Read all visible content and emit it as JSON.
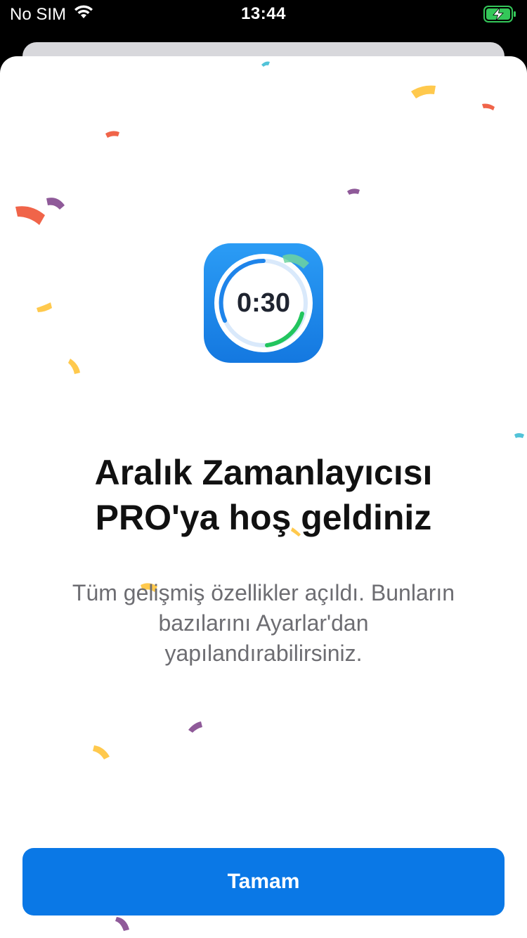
{
  "status_bar": {
    "carrier": "No SIM",
    "time": "13:44",
    "wifi_icon": "wifi-icon",
    "battery_icon": "battery-charging-icon",
    "battery_color": "#34c759"
  },
  "app_icon": {
    "icon": "interval-timer-app-icon",
    "time_label": "0:30"
  },
  "welcome": {
    "title_line1": "Aralık Zamanlayıcısı",
    "title_line2": "PRO'ya hoş geldiniz",
    "subtitle_line1": "Tüm gelişmiş özellikler açıldı. Bunların",
    "subtitle_line2": "bazılarını Ayarlar'dan",
    "subtitle_line3": "yapılandırabilirsiniz."
  },
  "actions": {
    "ok_label": "Tamam"
  },
  "colors": {
    "accent": "#0a78e6",
    "confetti": [
      "#f06449",
      "#ffc94d",
      "#8f5a99",
      "#52c3d8",
      "#6fd3a0"
    ]
  }
}
